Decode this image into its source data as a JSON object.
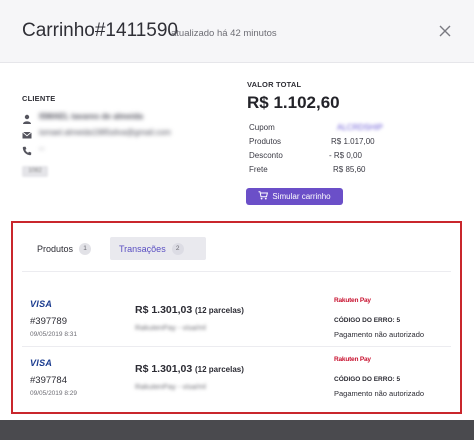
{
  "header": {
    "title": "Carrinho#1411590",
    "updated": "atualizado há 42 minutos"
  },
  "client": {
    "section_label": "CLIENTE",
    "name": "ISMAEL tavares de almeida",
    "email": "ismael.almeida1985silva@gmail.com",
    "phone": "--",
    "chip": "1082"
  },
  "totals": {
    "section_label": "VALOR TOTAL",
    "total": "R$ 1.102,60",
    "rows": [
      {
        "label": "Cupom",
        "value": "ALCRDSHIP"
      },
      {
        "label": "Produtos",
        "value": "R$ 1.017,00"
      },
      {
        "label": "Desconto",
        "value": "- R$ 0,00"
      },
      {
        "label": "Frete",
        "value": "R$ 85,60"
      }
    ],
    "simulate_label": "Simular carrinho"
  },
  "tabs": [
    {
      "label": "Produtos",
      "count": "1"
    },
    {
      "label": "Transações",
      "count": "2"
    }
  ],
  "transactions": [
    {
      "brand": "VISA",
      "id": "#397789",
      "date": "09/05/2019 8:31",
      "amount": "R$ 1.301,03",
      "installments": "(12 parcelas)",
      "gateway_line": "RakutenPay - visa/ml",
      "provider": "Rakuten Pay",
      "error_code": "CÓDIGO DO ERRO: 5",
      "error_message": "Pagamento não autorizado"
    },
    {
      "brand": "VISA",
      "id": "#397784",
      "date": "09/05/2019 8:29",
      "amount": "R$ 1.301,03",
      "installments": "(12 parcelas)",
      "gateway_line": "RakutenPay - visa/ml",
      "provider": "Rakuten Pay",
      "error_code": "CÓDIGO DO ERRO: 5",
      "error_message": "Pagamento não autorizado"
    }
  ],
  "colors": {
    "accent": "#6b4fc8",
    "highlight_border": "#c9262c",
    "visa_blue": "#1a3b8f",
    "rakuten_red": "#c8102e"
  }
}
